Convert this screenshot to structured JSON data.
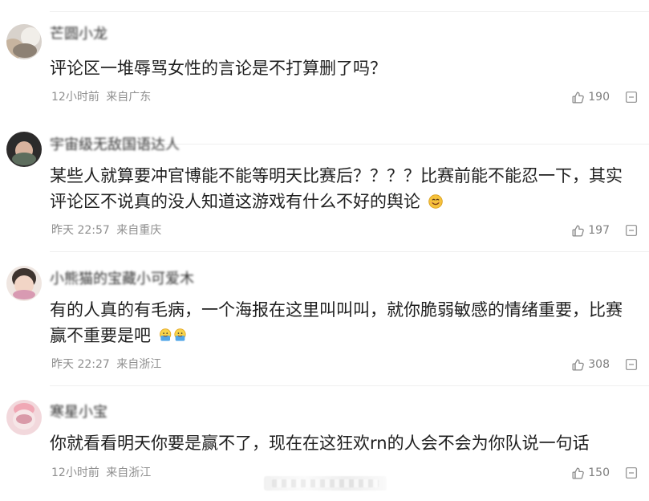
{
  "comments": [
    {
      "username": "芒圆小龙",
      "text": "评论区一堆辱骂女性的言论是不打算删了吗？",
      "time": "12小时前",
      "location": "来自广东",
      "likes": "190",
      "emoji_after_text": "none"
    },
    {
      "username": "宇宙级无敌国语达人",
      "text": "某些人就算要冲官博能不能等明天比赛后？？？？比赛前能不能忍一下，其实评论区不说真的没人知道这游戏有什么不好的舆论",
      "time": "昨天 22:57",
      "location": "来自重庆",
      "likes": "197",
      "emoji_after_text": "smile-emoji"
    },
    {
      "username": "小熊猫的宝藏小可爱木",
      "text": "有的人真的有毛病，一个海报在这里叫叫叫，就你脆弱敏感的情绪重要，比赛赢不重要是吧",
      "time": "昨天 22:27",
      "location": "来自浙江",
      "likes": "308",
      "emoji_after_text": "yellow-faces-emoji"
    },
    {
      "username": "寒星小宝",
      "text": "你就看看明天你要是赢不了，现在在这狂欢rn的人会不会为你队说一句话",
      "time": "12小时前",
      "location": "来自浙江",
      "likes": "150",
      "emoji_after_text": "none"
    }
  ],
  "icons": {
    "like": "thumb-up-icon",
    "more": "more-dots-icon"
  },
  "colors": {
    "text": "#1f1f1f",
    "meta": "#8f8f8f",
    "divider": "#efefef"
  }
}
